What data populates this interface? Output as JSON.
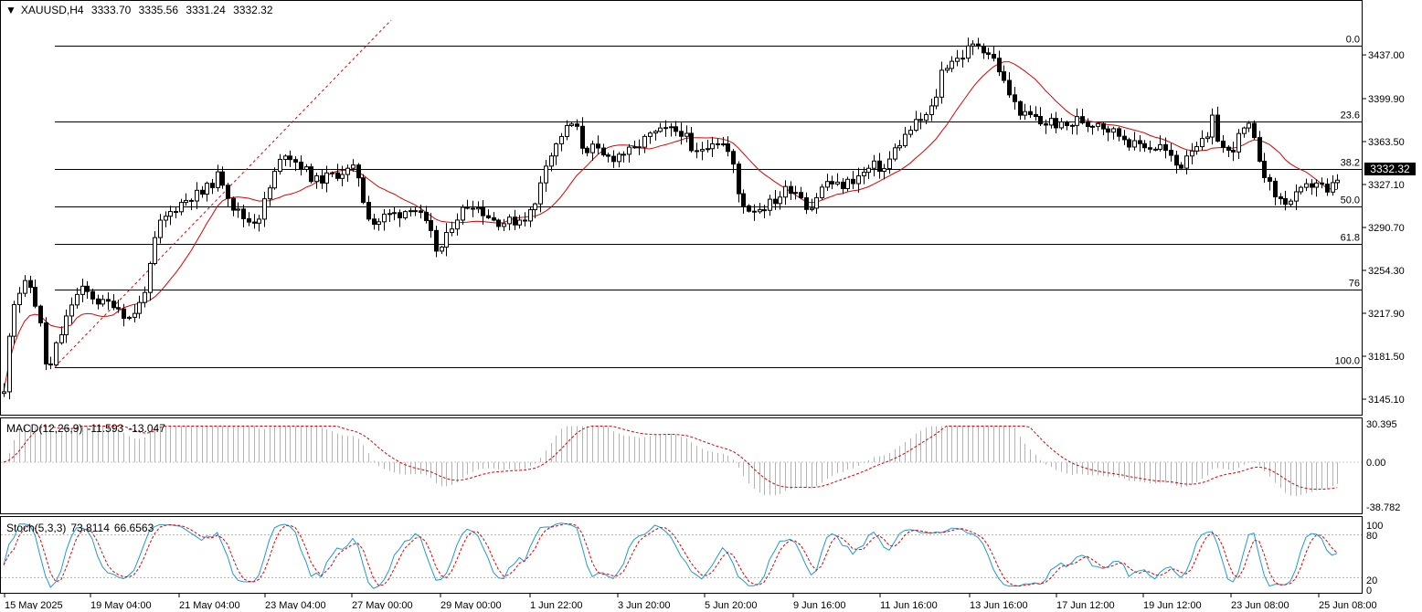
{
  "header": {
    "symbol": "XAUUSD,H4",
    "open": "3333.70",
    "high": "3335.56",
    "low": "3331.24",
    "close": "3332.32"
  },
  "current_price_tag": "3332.32",
  "price_axis_labels": [
    "3437.00",
    "3399.90",
    "3363.50",
    "3327.10",
    "3290.70",
    "3254.30",
    "3217.90",
    "3181.50",
    "3145.10"
  ],
  "fib_levels": [
    {
      "label": "0.0",
      "price": 3444.5
    },
    {
      "label": "23.6",
      "price": 3380.4
    },
    {
      "label": "38.2",
      "price": 3340.6
    },
    {
      "label": "50.0",
      "price": 3308.5
    },
    {
      "label": "61.8",
      "price": 3276.4
    },
    {
      "label": "76",
      "price": 3237.8
    },
    {
      "label": "100.0",
      "price": 3172.5
    }
  ],
  "time_axis_labels": [
    "15 May 2025",
    "19 May 04:00",
    "21 May 04:00",
    "23 May 04:00",
    "27 May 00:00",
    "29 May 00:00",
    "1 Jun 22:00",
    "3 Jun 20:00",
    "5 Jun 20:00",
    "9 Jun 16:00",
    "11 Jun 16:00",
    "13 Jun 16:00",
    "17 Jun 12:00",
    "19 Jun 12:00",
    "23 Jun 08:00",
    "25 Jun 08:00"
  ],
  "macd": {
    "label": "MACD(12,26,9)",
    "main": "-11.593",
    "signal": "-13.047",
    "axis_labels": [
      "30.395",
      "0.00",
      "-38.782"
    ]
  },
  "stoch": {
    "label": "Stoch(5,3,3)",
    "main": "73.8114",
    "signal": "66.6563",
    "axis_labels": [
      "100",
      "80",
      "20",
      "0"
    ]
  },
  "colors": {
    "candle": "#000000",
    "moving_average": "#e00000",
    "fib_line": "#000000",
    "fib_diagonal": "#e00000",
    "macd_histogram": "#b4b4b4",
    "macd_signal": "#e00000",
    "stoch_main": "#1e9ad6",
    "stoch_signal": "#e00000"
  },
  "chart_data": {
    "type": "candlestick",
    "symbol": "XAUUSD",
    "timeframe": "H4",
    "ylim": [
      3130,
      3465
    ],
    "anchors": [
      [
        4,
        3150
      ],
      [
        12,
        3223
      ],
      [
        25,
        3242
      ],
      [
        34,
        3240
      ],
      [
        44,
        3207
      ],
      [
        52,
        3162
      ],
      [
        60,
        3188
      ],
      [
        68,
        3203
      ],
      [
        78,
        3226
      ],
      [
        88,
        3238
      ],
      [
        98,
        3234
      ],
      [
        110,
        3226
      ],
      [
        125,
        3227
      ],
      [
        140,
        3213
      ],
      [
        152,
        3225
      ],
      [
        162,
        3249
      ],
      [
        172,
        3291
      ],
      [
        182,
        3300
      ],
      [
        195,
        3310
      ],
      [
        208,
        3317
      ],
      [
        222,
        3320
      ],
      [
        240,
        3336
      ],
      [
        255,
        3308
      ],
      [
        270,
        3296
      ],
      [
        282,
        3298
      ],
      [
        292,
        3318
      ],
      [
        302,
        3340
      ],
      [
        312,
        3355
      ],
      [
        330,
        3342
      ],
      [
        345,
        3330
      ],
      [
        360,
        3334
      ],
      [
        375,
        3338
      ],
      [
        390,
        3340
      ],
      [
        400,
        3305
      ],
      [
        410,
        3293
      ],
      [
        420,
        3300
      ],
      [
        430,
        3302
      ],
      [
        440,
        3303
      ],
      [
        450,
        3310
      ],
      [
        460,
        3300
      ],
      [
        470,
        3287
      ],
      [
        478,
        3270
      ],
      [
        485,
        3275
      ],
      [
        495,
        3295
      ],
      [
        505,
        3305
      ],
      [
        515,
        3312
      ],
      [
        530,
        3303
      ],
      [
        540,
        3297
      ],
      [
        550,
        3295
      ],
      [
        562,
        3296
      ],
      [
        575,
        3300
      ],
      [
        585,
        3308
      ],
      [
        595,
        3345
      ],
      [
        605,
        3355
      ],
      [
        615,
        3371
      ],
      [
        628,
        3380
      ],
      [
        638,
        3357
      ],
      [
        648,
        3358
      ],
      [
        660,
        3350
      ],
      [
        670,
        3350
      ],
      [
        680,
        3354
      ],
      [
        692,
        3355
      ],
      [
        705,
        3365
      ],
      [
        715,
        3370
      ],
      [
        730,
        3373
      ],
      [
        748,
        3372
      ],
      [
        758,
        3350
      ],
      [
        770,
        3360
      ],
      [
        780,
        3365
      ],
      [
        790,
        3362
      ],
      [
        800,
        3350
      ],
      [
        808,
        3318
      ],
      [
        818,
        3306
      ],
      [
        830,
        3307
      ],
      [
        840,
        3310
      ],
      [
        850,
        3315
      ],
      [
        862,
        3325
      ],
      [
        875,
        3320
      ],
      [
        885,
        3305
      ],
      [
        895,
        3320
      ],
      [
        905,
        3330
      ],
      [
        918,
        3325
      ],
      [
        930,
        3330
      ],
      [
        942,
        3335
      ],
      [
        955,
        3343
      ],
      [
        968,
        3340
      ],
      [
        978,
        3356
      ],
      [
        990,
        3368
      ],
      [
        1000,
        3378
      ],
      [
        1012,
        3384
      ],
      [
        1022,
        3395
      ],
      [
        1030,
        3423
      ],
      [
        1040,
        3433
      ],
      [
        1050,
        3434
      ],
      [
        1060,
        3443
      ],
      [
        1070,
        3446
      ],
      [
        1080,
        3440
      ],
      [
        1090,
        3430
      ],
      [
        1100,
        3410
      ],
      [
        1110,
        3395
      ],
      [
        1120,
        3385
      ],
      [
        1130,
        3385
      ],
      [
        1140,
        3378
      ],
      [
        1150,
        3381
      ],
      [
        1160,
        3376
      ],
      [
        1170,
        3377
      ],
      [
        1180,
        3383
      ],
      [
        1190,
        3378
      ],
      [
        1200,
        3381
      ],
      [
        1210,
        3375
      ],
      [
        1220,
        3371
      ],
      [
        1230,
        3367
      ],
      [
        1240,
        3360
      ],
      [
        1250,
        3362
      ],
      [
        1260,
        3358
      ],
      [
        1270,
        3360
      ],
      [
        1280,
        3350
      ],
      [
        1290,
        3340
      ],
      [
        1300,
        3357
      ],
      [
        1310,
        3362
      ],
      [
        1320,
        3362
      ],
      [
        1325,
        3385
      ],
      [
        1335,
        3360
      ],
      [
        1345,
        3353
      ],
      [
        1355,
        3367
      ],
      [
        1365,
        3378
      ],
      [
        1372,
        3363
      ],
      [
        1382,
        3340
      ],
      [
        1392,
        3320
      ],
      [
        1402,
        3313
      ],
      [
        1412,
        3313
      ],
      [
        1422,
        3320
      ],
      [
        1432,
        3326
      ],
      [
        1442,
        3330
      ],
      [
        1452,
        3318
      ],
      [
        1462,
        3332
      ]
    ]
  }
}
